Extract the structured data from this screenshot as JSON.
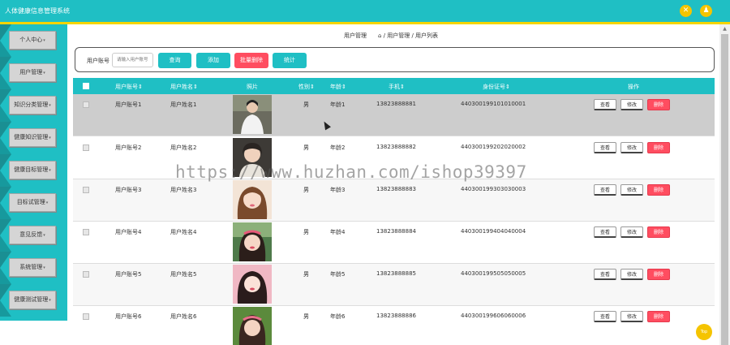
{
  "app": {
    "title": "人体健康信息管理系统"
  },
  "header": {
    "close_icon_glyph": "✕",
    "user_icon_glyph": "♟",
    "accent": "#1fbfc4",
    "yellow": "#f5c400"
  },
  "sidebar": {
    "items": [
      {
        "label": "个人中心"
      },
      {
        "label": "用户管理"
      },
      {
        "label": "知识分类管理"
      },
      {
        "label": "健康知识管理"
      },
      {
        "label": "健康目标管理"
      },
      {
        "label": "目标试管理"
      },
      {
        "label": "意见反馈"
      },
      {
        "label": "系统管理"
      },
      {
        "label": "健康测试管理"
      }
    ]
  },
  "breadcrumb": {
    "left": "用户管理",
    "path": "⌂ / 用户管理 / 用户列表"
  },
  "search": {
    "label": "用户账号",
    "placeholder": "请输入用户账号",
    "query_label": "查询",
    "add_label": "添加",
    "batch_delete_label": "批量删除",
    "stats_label": "统计",
    "delete_color": "#ff4d60"
  },
  "table": {
    "headers": {
      "account": "用户账号⇕",
      "name": "用户姓名⇕",
      "photo": "照片",
      "gender": "性别⇕",
      "age": "年龄⇕",
      "phone": "手机⇕",
      "idcard": "身份证号⇕",
      "actions": "操作"
    },
    "view_label": "查看",
    "edit_label": "修改",
    "delete_label": "删除",
    "rows": [
      {
        "account": "用户账号1",
        "name": "用户姓名1",
        "gender": "男",
        "age": "年龄1",
        "phone": "13823888881",
        "idcard": "440300199101010001"
      },
      {
        "account": "用户账号2",
        "name": "用户姓名2",
        "gender": "男",
        "age": "年龄2",
        "phone": "13823888882",
        "idcard": "440300199202020002"
      },
      {
        "account": "用户账号3",
        "name": "用户姓名3",
        "gender": "男",
        "age": "年龄3",
        "phone": "13823888883",
        "idcard": "440300199303030003"
      },
      {
        "account": "用户账号4",
        "name": "用户姓名4",
        "gender": "男",
        "age": "年龄4",
        "phone": "13823888884",
        "idcard": "440300199404040004"
      },
      {
        "account": "用户账号5",
        "name": "用户姓名5",
        "gender": "男",
        "age": "年龄5",
        "phone": "13823888885",
        "idcard": "440300199505050005"
      },
      {
        "account": "用户账号6",
        "name": "用户姓名6",
        "gender": "男",
        "age": "年龄6",
        "phone": "13823888886",
        "idcard": "440300199606060006"
      }
    ]
  },
  "watermark": {
    "text": "https://www.huzhan.com/ishop39397"
  },
  "top_button": {
    "label": "Top"
  }
}
